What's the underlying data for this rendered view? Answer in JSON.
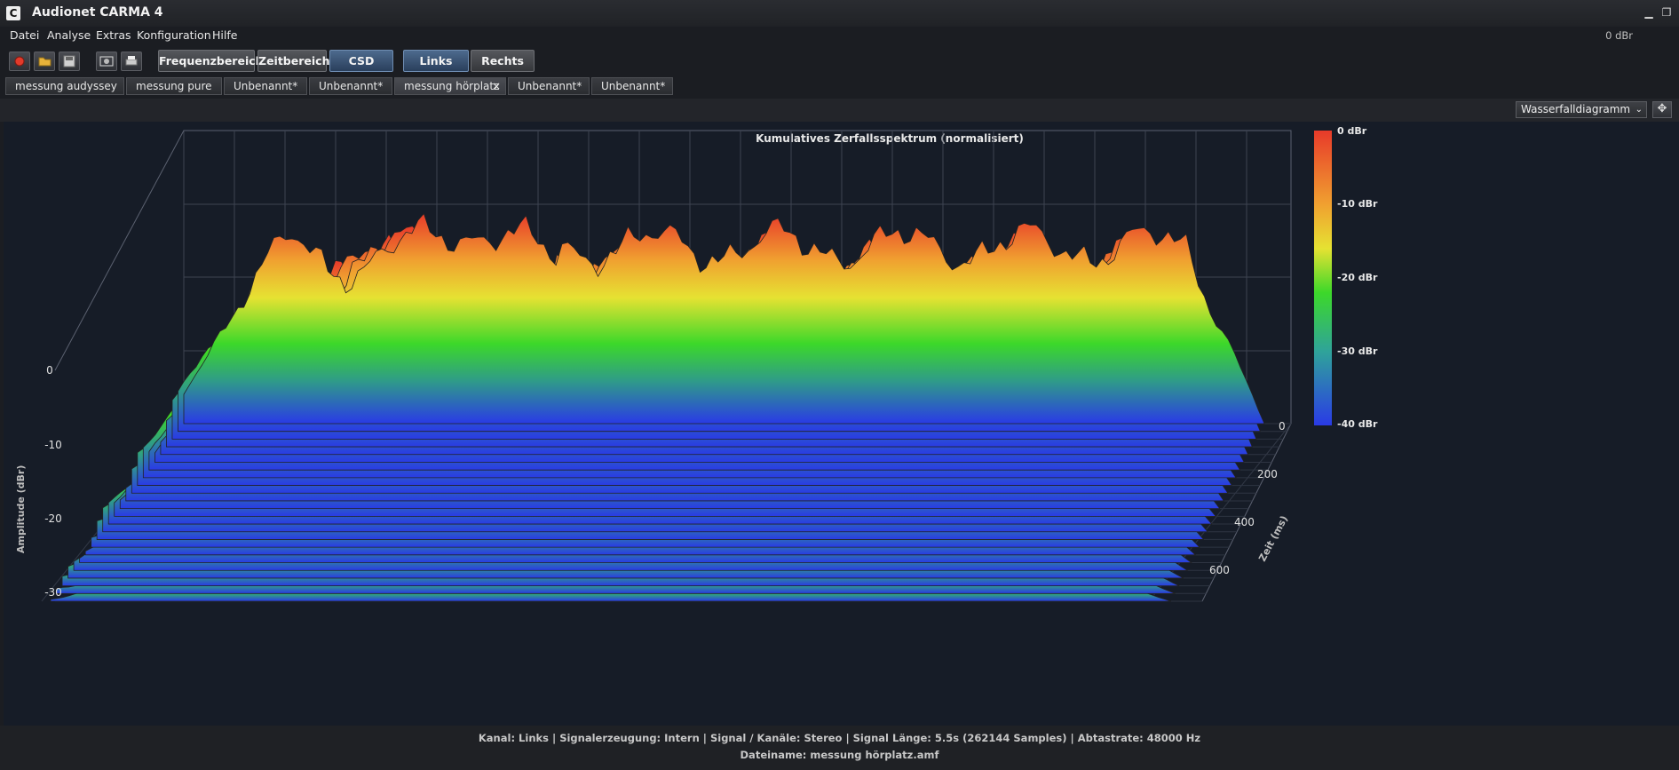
{
  "app": {
    "title": "Audionet CARMA 4",
    "icon_letter": "C",
    "level_readout": "0 dBr"
  },
  "window_controls": {
    "minimize_glyph": "▁",
    "restore_glyph": "❐"
  },
  "menu": [
    "Datei",
    "Analyse",
    "Extras",
    "Konfiguration",
    "Hilfe"
  ],
  "toolbar": {
    "icons": [
      "record-icon",
      "open-folder-icon",
      "save-icon",
      "screenshot-icon",
      "print-icon"
    ],
    "view_buttons": [
      {
        "label": "Frequenzbereich",
        "active": false
      },
      {
        "label": "Zeitbereich",
        "active": false
      },
      {
        "label": "CSD",
        "active": true
      }
    ],
    "channel_buttons": [
      {
        "label": "Links",
        "active": true
      },
      {
        "label": "Rechts",
        "active": false
      }
    ]
  },
  "tabs": [
    {
      "label": "messung audyssey",
      "active": false
    },
    {
      "label": "messung pure",
      "active": false
    },
    {
      "label": "Unbenannt*",
      "active": false
    },
    {
      "label": "Unbenannt*",
      "active": false
    },
    {
      "label": "messung hörplatz",
      "active": true,
      "close": "×"
    },
    {
      "label": "Unbenannt*",
      "active": false
    },
    {
      "label": "Unbenannt*",
      "active": false
    }
  ],
  "view_select": {
    "value": "Wasserfalldiagramm",
    "arrow": "⌄"
  },
  "move_button_glyph": "✥",
  "chart_data": {
    "type": "area",
    "title": "Kumulatives Zerfallsspektrum (normalisiert)",
    "ylabel": "Amplitude (dBr)",
    "zlabel": "Zeit (ms)",
    "y_ticks": [
      "0",
      "-10",
      "-20",
      "-30"
    ],
    "z_ticks": [
      "0",
      "200",
      "400",
      "600"
    ],
    "colorbar_ticks": [
      "0 dBr",
      "-10 dBr",
      "-20 dBr",
      "-30 dBr",
      "-40 dBr"
    ],
    "colorbar_colors": [
      "#e83a2a",
      "#f0a030",
      "#e6e232",
      "#3cd82a",
      "#2a3ae6"
    ],
    "slices": 24
  },
  "status": {
    "line1": "Kanal: Links  |  Signalerzeugung: Intern  |  Signal / Kanäle: Stereo  |  Signal Länge: 5.5s (262144 Samples)  |  Abtastrate: 48000 Hz",
    "line2": "Dateiname: messung hörplatz.amf"
  }
}
